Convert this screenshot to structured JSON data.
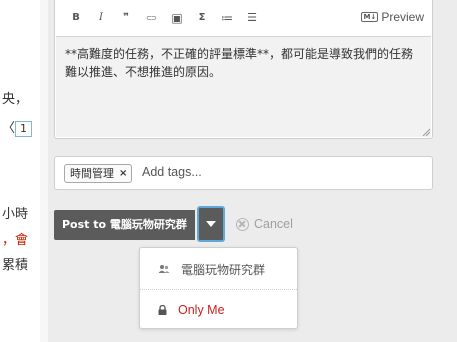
{
  "background": {
    "lines": [
      {
        "text": "央，"
      },
      {
        "text": "1"
      },
      {
        "text": "小時"
      },
      {
        "text": "，會"
      },
      {
        "text": "累積"
      }
    ]
  },
  "toolbar": {
    "buttons": [
      {
        "name": "bold-button",
        "icon": "bold-icon",
        "glyph": "B"
      },
      {
        "name": "italic-button",
        "icon": "italic-icon",
        "glyph": "I"
      },
      {
        "name": "quote-button",
        "icon": "quote-icon",
        "glyph": "❞"
      },
      {
        "name": "link-button",
        "icon": "link-icon",
        "glyph": "⊂⊃"
      },
      {
        "name": "image-button",
        "icon": "image-icon",
        "glyph": "▣"
      },
      {
        "name": "math-button",
        "icon": "sigma-icon",
        "glyph": "Σ"
      },
      {
        "name": "ordered-list-button",
        "icon": "ordered-list-icon",
        "glyph": "≔"
      },
      {
        "name": "bullet-list-button",
        "icon": "bullet-list-icon",
        "glyph": "☰"
      }
    ],
    "preview_badge": "M↓",
    "preview_label": "Preview"
  },
  "editor": {
    "text": "**高難度的任務，不正確的評量標準**，都可能是導致我們的任務難以推進、不想推進的原因。"
  },
  "tags": {
    "items": [
      {
        "label": "時間管理",
        "remove_glyph": "×"
      }
    ],
    "placeholder": "Add tags..."
  },
  "actions": {
    "post_label": "Post to 電腦玩物研究群",
    "cancel_label": "Cancel"
  },
  "dropdown": {
    "items": [
      {
        "label": "電腦玩物研究群",
        "icon": "group-icon"
      },
      {
        "label": "Only Me",
        "icon": "lock-icon"
      }
    ]
  },
  "colors": {
    "post_button": "#5b5b5b",
    "focus_outline": "#5fa8d8",
    "only_me": "#cc1f1f",
    "annotation_red": "#cc2200"
  }
}
